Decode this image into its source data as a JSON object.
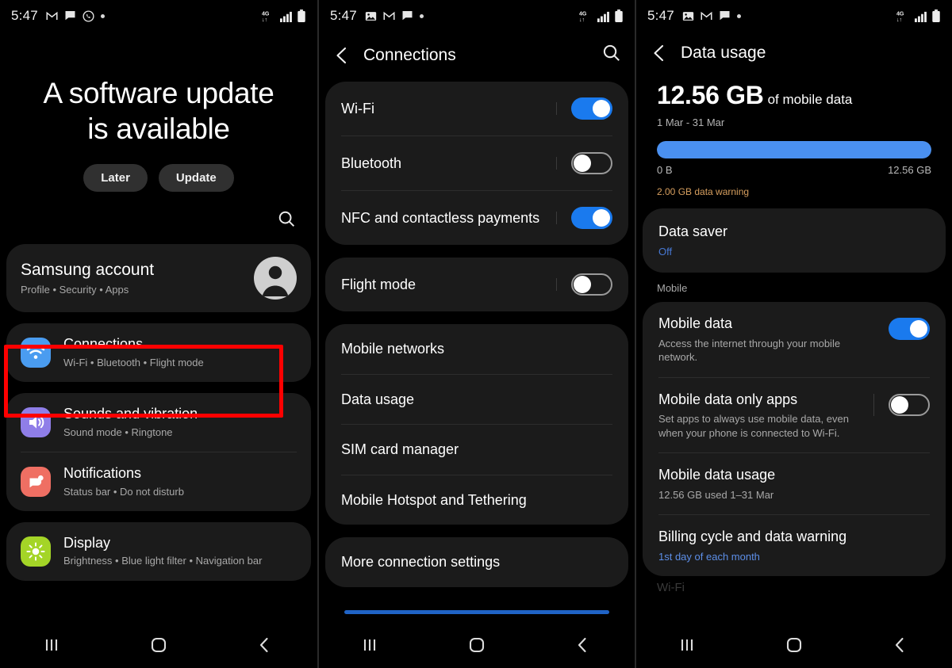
{
  "statusbar": {
    "time": "5:47",
    "panel1_icons": [
      "gmail-icon",
      "message-icon",
      "whatsapp-icon",
      "dot-icon"
    ],
    "panel23_icons": [
      "image-icon",
      "gmail-icon",
      "message-icon",
      "dot-icon"
    ],
    "network": "4G",
    "signal": "signal-bars-icon",
    "battery": "battery-icon"
  },
  "colors": {
    "accent_blue": "#1a7aee",
    "bar_blue": "#4a90f0",
    "annotation_red": "#fe0000",
    "warning_orange": "#d79f5f",
    "link_blue": "#4778d4",
    "card_bg": "#1b1b1b"
  },
  "panel1": {
    "update": {
      "title_line1": "A software update",
      "title_line2": "is available",
      "later_label": "Later",
      "update_label": "Update"
    },
    "search_icon": "search-icon",
    "account": {
      "title": "Samsung account",
      "subtitle": "Profile  •  Security  •  Apps",
      "avatar": "person-avatar"
    },
    "items": [
      {
        "title": "Connections",
        "subtitle": "Wi-Fi  •  Bluetooth  •  Flight mode",
        "icon": "wifi-icon",
        "icon_color": "#4a9cf0"
      },
      {
        "title": "Sounds and vibration",
        "subtitle": "Sound mode  •  Ringtone",
        "icon": "speaker-icon",
        "icon_color": "#8f7ee8"
      },
      {
        "title": "Notifications",
        "subtitle": "Status bar  •  Do not disturb",
        "icon": "notification-bubble-icon",
        "icon_color": "#ef6f63"
      },
      {
        "title": "Display",
        "subtitle": "Brightness  •  Blue light filter  •  Navigation bar",
        "icon": "brightness-icon",
        "icon_color": "#a4d527"
      }
    ]
  },
  "panel2": {
    "appbar": {
      "back_icon": "back-chevron-icon",
      "title": "Connections",
      "search_icon": "search-icon"
    },
    "group1": [
      {
        "label": "Wi-Fi",
        "toggle": "on"
      },
      {
        "label": "Bluetooth",
        "toggle": "off"
      },
      {
        "label": "NFC and contactless payments",
        "toggle": "on"
      }
    ],
    "group2": [
      {
        "label": "Flight mode",
        "toggle": "off"
      }
    ],
    "group3": [
      {
        "label": "Mobile networks"
      },
      {
        "label": "Data usage"
      },
      {
        "label": "SIM card manager"
      },
      {
        "label": "Mobile Hotspot and Tethering"
      }
    ],
    "group4": [
      {
        "label": "More connection settings"
      }
    ]
  },
  "panel3": {
    "appbar": {
      "back_icon": "back-chevron-icon",
      "title": "Data usage"
    },
    "summary": {
      "amount": "12.56 GB",
      "of_label": "of mobile data",
      "date_range": "1 Mar - 31 Mar",
      "bar_percent": 100,
      "scale_min": "0 B",
      "scale_max": "12.56 GB",
      "warning": "2.00 GB data warning"
    },
    "data_saver": {
      "title": "Data saver",
      "status": "Off"
    },
    "section_label": "Mobile",
    "mobile_rows": [
      {
        "title": "Mobile data",
        "subtitle": "Access the internet through your mobile network.",
        "toggle": "on"
      },
      {
        "title": "Mobile data only apps",
        "subtitle": "Set apps to always use mobile data, even when your phone is connected to Wi-Fi.",
        "toggle": "off"
      },
      {
        "title": "Mobile data usage",
        "subtitle": "12.56 GB used 1–31 Mar"
      },
      {
        "title": "Billing cycle and data warning",
        "subtitle": "1st day of each month",
        "sub_link": true
      }
    ],
    "cut_label": "Wi-Fi"
  },
  "navbar": {
    "recents": "recents-icon",
    "home": "home-icon",
    "back": "back-icon"
  }
}
